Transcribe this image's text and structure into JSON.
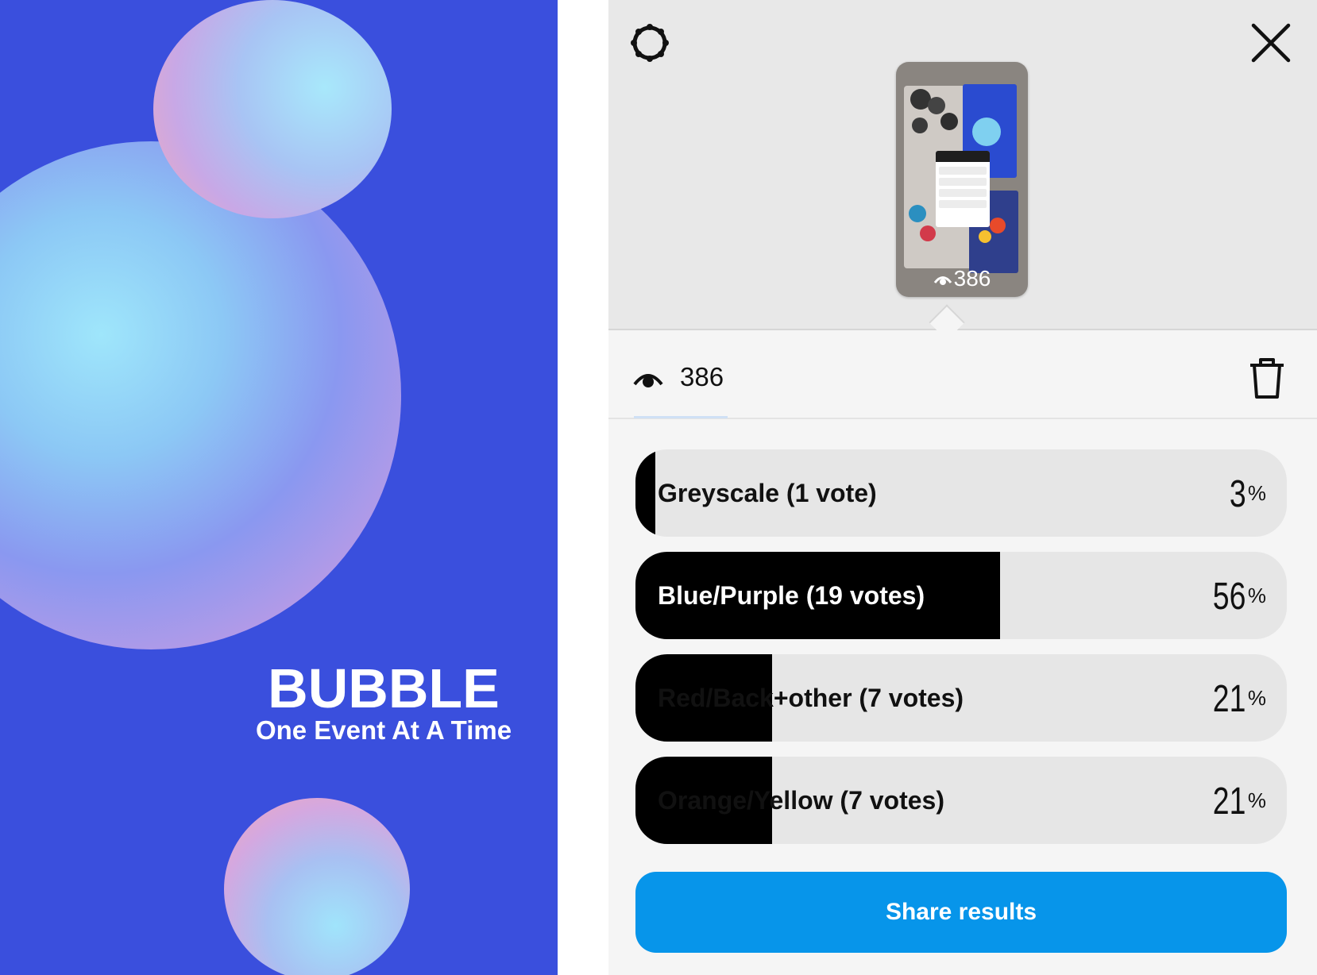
{
  "poster": {
    "title": "BUBBLE",
    "subtitle": "One Event At A Time",
    "background_color": "#3a4fdd"
  },
  "header": {
    "settings_icon": "gear-icon",
    "close_icon": "close-icon",
    "thumbnail": {
      "views": "386",
      "views_icon": "eye-icon"
    }
  },
  "stats": {
    "views_icon": "eye-icon",
    "views": "386",
    "delete_icon": "trash-icon"
  },
  "poll": {
    "options": [
      {
        "label": "Greyscale (1 vote)",
        "percent_num": "3",
        "percent_unit": "%",
        "fill_fraction": 0.03
      },
      {
        "label": "Blue/Purple (19 votes)",
        "percent_num": "56",
        "percent_unit": "%",
        "fill_fraction": 0.56
      },
      {
        "label": "Red/Back+other (7 votes)",
        "percent_num": "21",
        "percent_unit": "%",
        "fill_fraction": 0.21
      },
      {
        "label": "Orange/Yellow (7 votes)",
        "percent_num": "21",
        "percent_unit": "%",
        "fill_fraction": 0.21
      }
    ]
  },
  "share": {
    "label": "Share results",
    "color": "#0795ea"
  }
}
